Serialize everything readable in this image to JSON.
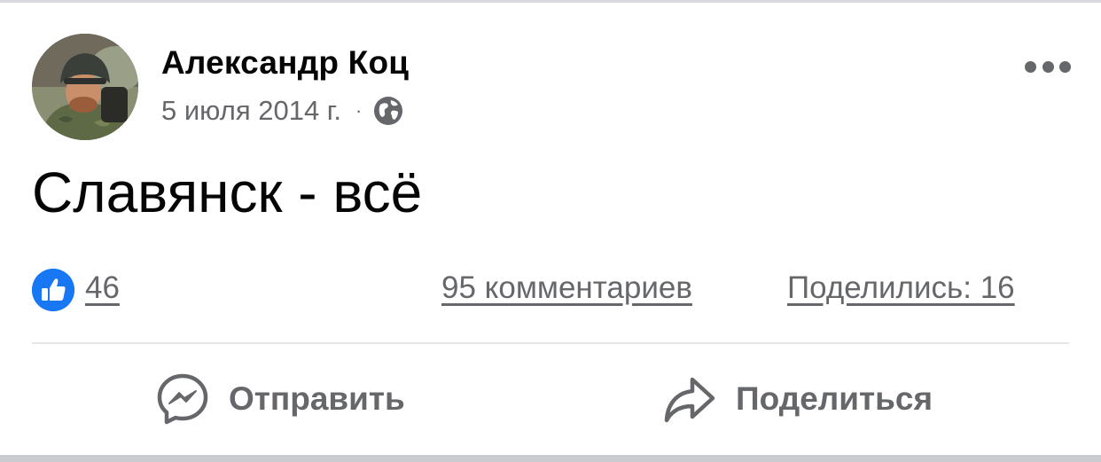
{
  "post": {
    "author": "Александр Коц",
    "date": "5 июля 2014 г.",
    "separator": "·",
    "privacy_icon": "globe-icon",
    "more_icon": "more-icon",
    "text": "Славянск - всё"
  },
  "reactions": {
    "like_icon": "like-icon",
    "like_count": "46",
    "comments": "95 комментариев",
    "shares": "Поделились: 16"
  },
  "actions": {
    "send_label": "Отправить",
    "send_icon": "messenger-icon",
    "share_label": "Поделиться",
    "share_icon": "share-arrow-icon"
  },
  "colors": {
    "text_primary": "#050505",
    "text_secondary": "#65676b",
    "like_blue": "#1877f2",
    "divider": "#e4e6eb"
  }
}
